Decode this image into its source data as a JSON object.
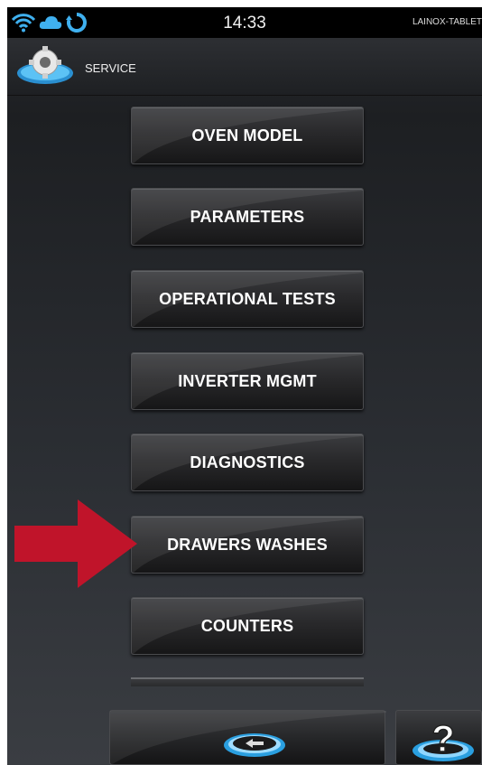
{
  "status_bar": {
    "time": "14:33",
    "device_name": "LAINOX-TABLET",
    "icons": [
      "wifi-icon",
      "cloud-icon",
      "sync-icon"
    ]
  },
  "action_bar": {
    "title": "SERVICE",
    "icon": "gear-icon"
  },
  "menu": {
    "items": [
      {
        "label": "OVEN MODEL"
      },
      {
        "label": "PARAMETERS"
      },
      {
        "label": "OPERATIONAL TESTS"
      },
      {
        "label": "INVERTER MGMT"
      },
      {
        "label": "DIAGNOSTICS"
      },
      {
        "label": "DRAWERS WASHES",
        "highlighted": true
      },
      {
        "label": "COUNTERS"
      }
    ]
  },
  "bottom_bar": {
    "back_icon": "back-icon",
    "help_symbol": "?"
  },
  "colors": {
    "highlight_arrow": "#c0142a",
    "accent_blue": "#2a9fe0"
  }
}
